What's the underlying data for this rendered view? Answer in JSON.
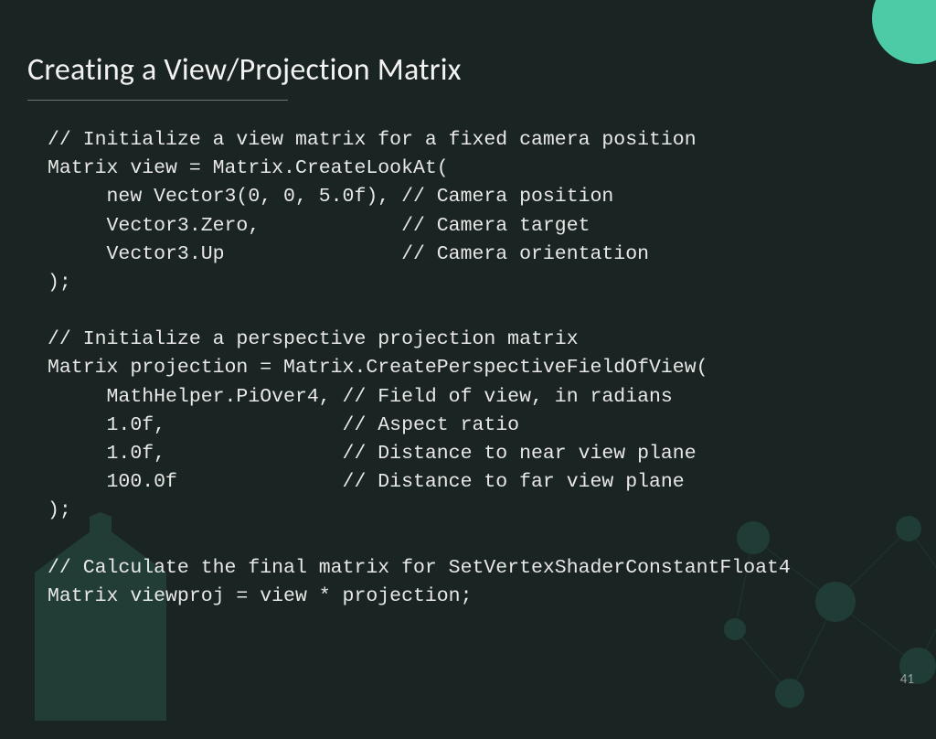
{
  "slide": {
    "title": "Creating a View/Projection Matrix",
    "page_number": "41",
    "code": "// Initialize a view matrix for a fixed camera position\nMatrix view = Matrix.CreateLookAt(\n     new Vector3(0, 0, 5.0f), // Camera position\n     Vector3.Zero,            // Camera target\n     Vector3.Up               // Camera orientation\n);\n\n// Initialize a perspective projection matrix\nMatrix projection = Matrix.CreatePerspectiveFieldOfView(\n     MathHelper.PiOver4, // Field of view, in radians\n     1.0f,               // Aspect ratio\n     1.0f,               // Distance to near view plane\n     100.0f              // Distance to far view plane\n);\n\n// Calculate the final matrix for SetVertexShaderConstantFloat4\nMatrix viewproj = view * projection;"
  }
}
